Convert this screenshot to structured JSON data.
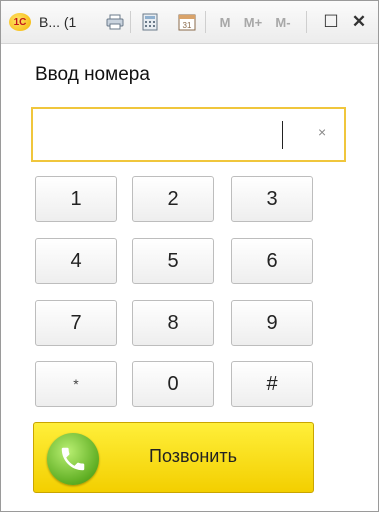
{
  "titlebar": {
    "app_logo": "1С",
    "title": "В... (1",
    "icons": [
      "print-icon",
      "calculator-icon",
      "calendar-icon"
    ],
    "calendar_day": "31",
    "memory_buttons": [
      "M",
      "M+",
      "M-"
    ],
    "window_buttons": [
      "maximize-icon",
      "close-icon"
    ],
    "close_glyph": "✕",
    "maximize_glyph": "☐"
  },
  "form": {
    "heading": "Ввод номера",
    "phone_value": "",
    "clear_glyph": "×"
  },
  "keypad": {
    "keys": [
      "1",
      "2",
      "3",
      "4",
      "5",
      "6",
      "7",
      "8",
      "9",
      "*",
      "0",
      "#"
    ]
  },
  "call_button": {
    "label": "Позвонить",
    "icon": "phone-icon"
  },
  "colors": {
    "input_border": "#f0c63c",
    "call_button_bg": "#f6d800",
    "call_icon": "#5fae23"
  }
}
